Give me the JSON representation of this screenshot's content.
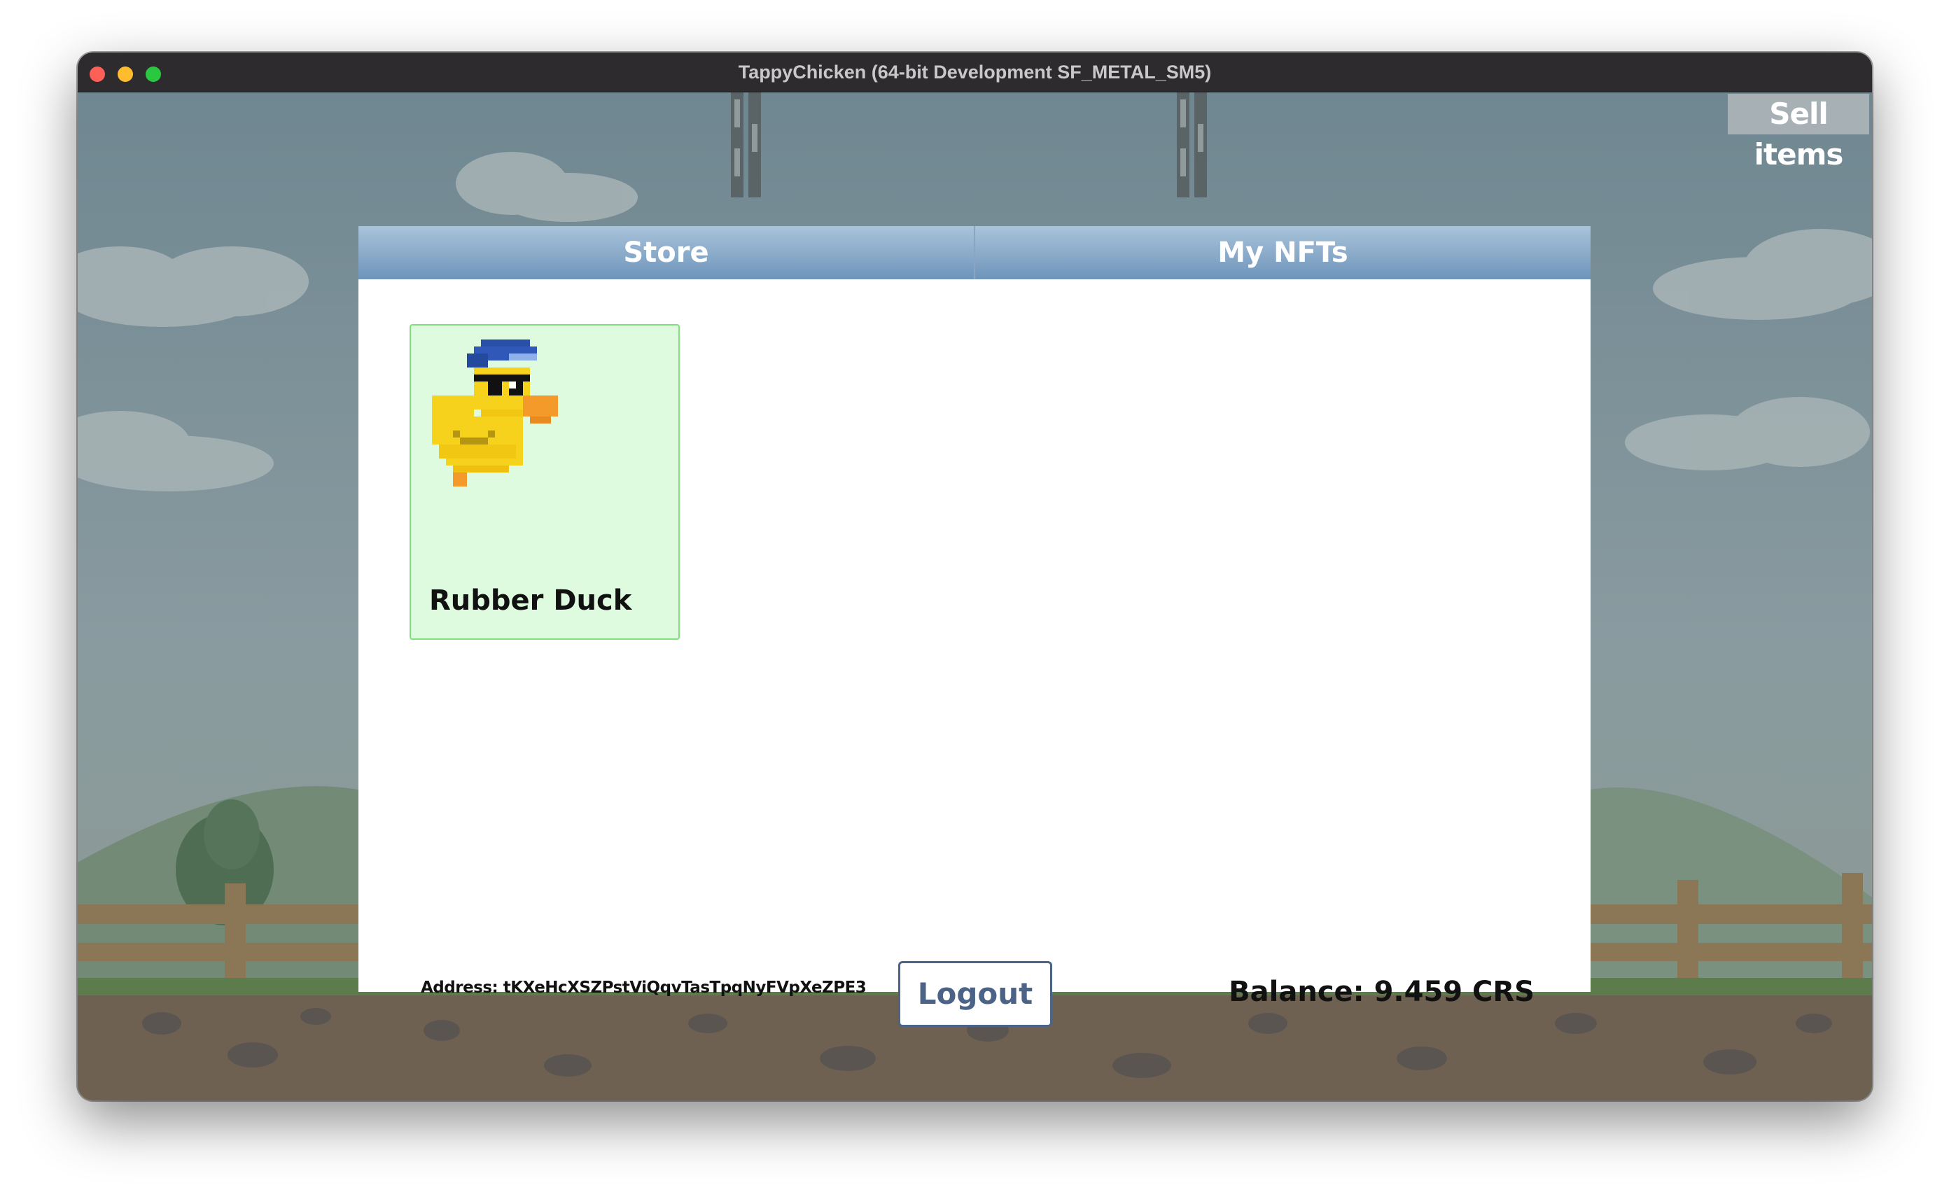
{
  "window": {
    "title": "TappyChicken (64-bit Development SF_METAL_SM5)"
  },
  "toolbar": {
    "sell_items_label": "Sell items"
  },
  "tabs": [
    {
      "label": "Store"
    },
    {
      "label": "My NFTs"
    }
  ],
  "items": [
    {
      "name": "Rubber Duck",
      "icon": "rubber-duck-with-sunglasses-icon"
    }
  ],
  "footer": {
    "address": "Address: tKXeHcXSZPstViQqvTasTpqNyFVpXeZPE3",
    "logout_label": "Logout",
    "balance": "Balance: 9.459 CRS"
  },
  "colors": {
    "tab_bar": "#7b9ec2",
    "card_background": "#dffbdf",
    "card_border": "#7fe07f",
    "logout_accent": "#4a6387"
  }
}
